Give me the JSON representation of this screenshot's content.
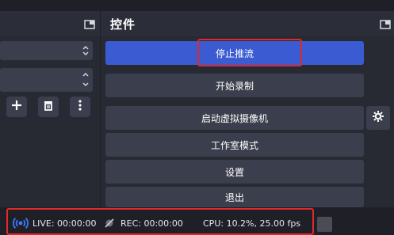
{
  "controls": {
    "title": "控件",
    "buttons": {
      "stop_stream": "停止推流",
      "start_recording": "开始录制",
      "start_virtual_camera": "启动虚拟摄像机",
      "studio_mode": "工作室模式",
      "settings": "设置",
      "exit": "退出"
    }
  },
  "status_bar": {
    "live": "LIVE: 00:00:00",
    "rec": "REC: 00:00:00",
    "cpu": "CPU: 10.2%, 25.00 fps"
  },
  "colors": {
    "primary": "#3b5bd2",
    "highlight": "#e02a2a",
    "panel": "#272a33",
    "button": "#3b3e4c",
    "background": "#1f1f27"
  },
  "icons": {
    "left_float": "float-dock-icon",
    "controls_float": "float-dock-icon",
    "add": "plus-icon",
    "remove": "trash-icon",
    "more": "kebab-icon",
    "gear": "gear-icon",
    "live": "broadcast-icon",
    "rec": "record-off-icon"
  }
}
